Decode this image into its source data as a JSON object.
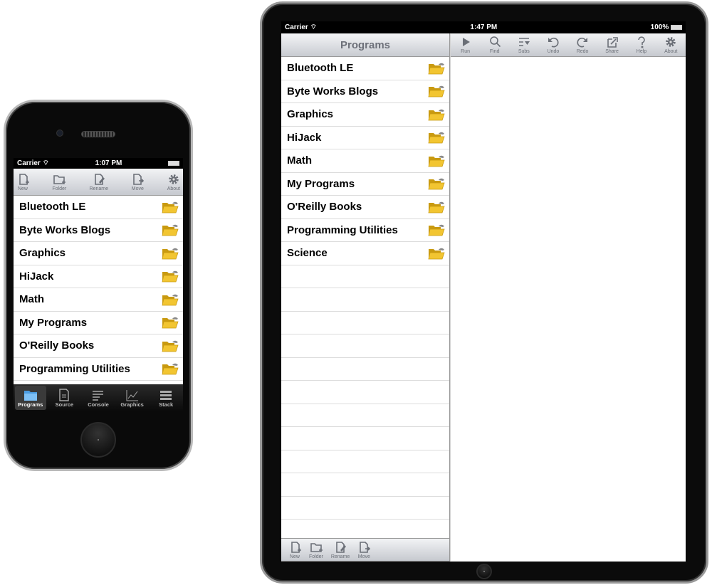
{
  "iphone": {
    "status": {
      "carrier": "Carrier",
      "time": "1:07 PM"
    },
    "toolbar": [
      {
        "label": "New",
        "icon": "new-file-icon"
      },
      {
        "label": "Folder",
        "icon": "new-folder-icon"
      },
      {
        "label": "Rename",
        "icon": "rename-icon"
      },
      {
        "label": "Move",
        "icon": "move-icon"
      },
      {
        "label": "About",
        "icon": "gear-icon"
      }
    ],
    "items": [
      "Bluetooth LE",
      "Byte Works Blogs",
      "Graphics",
      "HiJack",
      "Math",
      "My Programs",
      "O'Reilly Books",
      "Programming Utilities"
    ],
    "tabs": [
      {
        "label": "Programs",
        "icon": "folder-icon",
        "active": true
      },
      {
        "label": "Source",
        "icon": "document-icon"
      },
      {
        "label": "Console",
        "icon": "console-icon"
      },
      {
        "label": "Graphics",
        "icon": "graph-icon"
      },
      {
        "label": "Stack",
        "icon": "stack-icon"
      }
    ]
  },
  "ipad": {
    "status": {
      "carrier": "Carrier",
      "time": "1:47 PM",
      "battery": "100%"
    },
    "panel_title": "Programs",
    "toolbar": [
      {
        "label": "Run",
        "icon": "play-icon"
      },
      {
        "label": "Find",
        "icon": "search-icon"
      },
      {
        "label": "Subs",
        "icon": "subs-icon"
      },
      {
        "label": "Undo",
        "icon": "undo-icon"
      },
      {
        "label": "Redo",
        "icon": "redo-icon"
      },
      {
        "label": "Share",
        "icon": "share-icon"
      },
      {
        "label": "Help",
        "icon": "help-icon"
      },
      {
        "label": "About",
        "icon": "gear-icon"
      }
    ],
    "items": [
      "Bluetooth LE",
      "Byte Works Blogs",
      "Graphics",
      "HiJack",
      "Math",
      "My Programs",
      "O'Reilly Books",
      "Programming Utilities",
      "Science"
    ],
    "bottom_toolbar": [
      {
        "label": "New",
        "icon": "new-file-icon"
      },
      {
        "label": "Folder",
        "icon": "new-folder-icon"
      },
      {
        "label": "Rename",
        "icon": "rename-icon"
      },
      {
        "label": "Move",
        "icon": "move-icon"
      }
    ]
  },
  "colors": {
    "folder": "#f2c531",
    "active_tab": "#4a9be0"
  }
}
